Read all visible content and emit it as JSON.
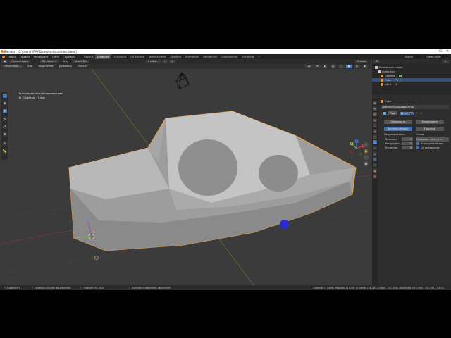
{
  "titlebar": {
    "title": "Blender* [C:\\Users\\VRAY\\Downloads\\untitled.blend]",
    "minimize": "—",
    "maximize": "☐",
    "close": "✕"
  },
  "menubar": {
    "items": [
      "Файл",
      "Правка",
      "Рендеринг",
      "Окно",
      "Справка"
    ],
    "workspaces": [
      "Layout",
      "Modeling",
      "Sculpting",
      "UV Editing",
      "Texture Paint",
      "Shading",
      "Animation",
      "Rendering",
      "Compositing",
      "Scripting"
    ],
    "active_workspace": "Modeling",
    "scene": "Scene",
    "view_layer": "View Layer"
  },
  "toolheader": {
    "mode": "Ориентация",
    "pivot": "По умолч...",
    "drag": "Drag",
    "select": "Select Box",
    "transform": "Глоба...",
    "options": "Опции"
  },
  "viewheader": {
    "mode": "Объектный ...",
    "view": "Вид",
    "select": "Выделение",
    "add": "Добавить",
    "object": "Объект"
  },
  "viewport": {
    "perspective": "Пользовательская перспектива",
    "collection": "(1) Collection | Cube"
  },
  "gizmo": {
    "x": "X",
    "y": "Y",
    "z": "Z"
  },
  "outliner": {
    "header": "Коллекция сцены",
    "rows": [
      {
        "label": "Collection",
        "icon_color": "#cfcfcf"
      },
      {
        "label": "Camera",
        "icon_color": "#e09a4a"
      },
      {
        "label": "Cube",
        "icon_color": "#e09a4a"
      },
      {
        "label": "Light",
        "icon_color": "#e09a4a"
      }
    ]
  },
  "properties": {
    "object": "Cube",
    "add_modifier": "Добавить модификатор",
    "modifier_name": "Под",
    "apply": "Применить",
    "copy": "Копировать",
    "catmull": "Катмулл-Кларк",
    "simple": "Простое",
    "subdivisions": "Подразделения",
    "viewport_label": "Вьюпорт",
    "viewport_value": "1",
    "render_label": "Рендеринг",
    "render_value": "2",
    "quality_label": "Качество",
    "quality_value": "3",
    "options": "Опции",
    "uv_smooth": "Сглажива.. хоть угл..",
    "optimal_display": "Упрощённый вид",
    "use_creases": "Со складками"
  },
  "statusbar": {
    "select": "Выделить",
    "box_select": "Прямоугольное выделение",
    "rotate": "Повернуть вид",
    "context": "Контекстное меню объектов",
    "stats": "Collection | Cube | Вершин 127,097 | Граней 126,162 | Треуг. 252,304 | Объектов 1/3 | Пам.: 35.1 МБ | 2.83.5"
  },
  "colors": {
    "accent": "#4772b3",
    "selection_outline": "#f0a23c",
    "mesh": "#b9b9b9",
    "cursor_dot": "#2b2bd6"
  }
}
